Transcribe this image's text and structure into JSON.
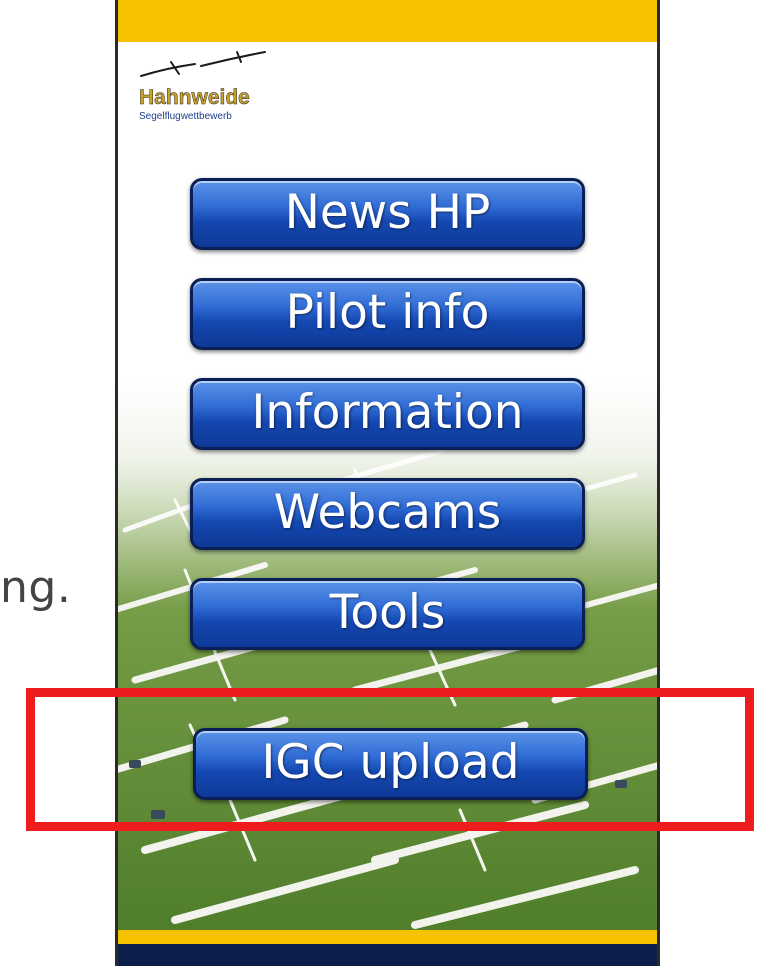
{
  "background_text": "ng.",
  "logo": {
    "wordmark": "Hahnweide",
    "subtitle": "Segelflugwettbewerb"
  },
  "menu": {
    "items": [
      {
        "label": "News HP"
      },
      {
        "label": "Pilot info"
      },
      {
        "label": "Information"
      },
      {
        "label": "Webcams"
      },
      {
        "label": "Tools"
      },
      {
        "label": "IGC upload"
      }
    ]
  },
  "colors": {
    "top_bar": "#f6c200",
    "button_blue": "#1447b0",
    "highlight": "#ee1c1c",
    "bottom_navy": "#0d1f4a"
  }
}
